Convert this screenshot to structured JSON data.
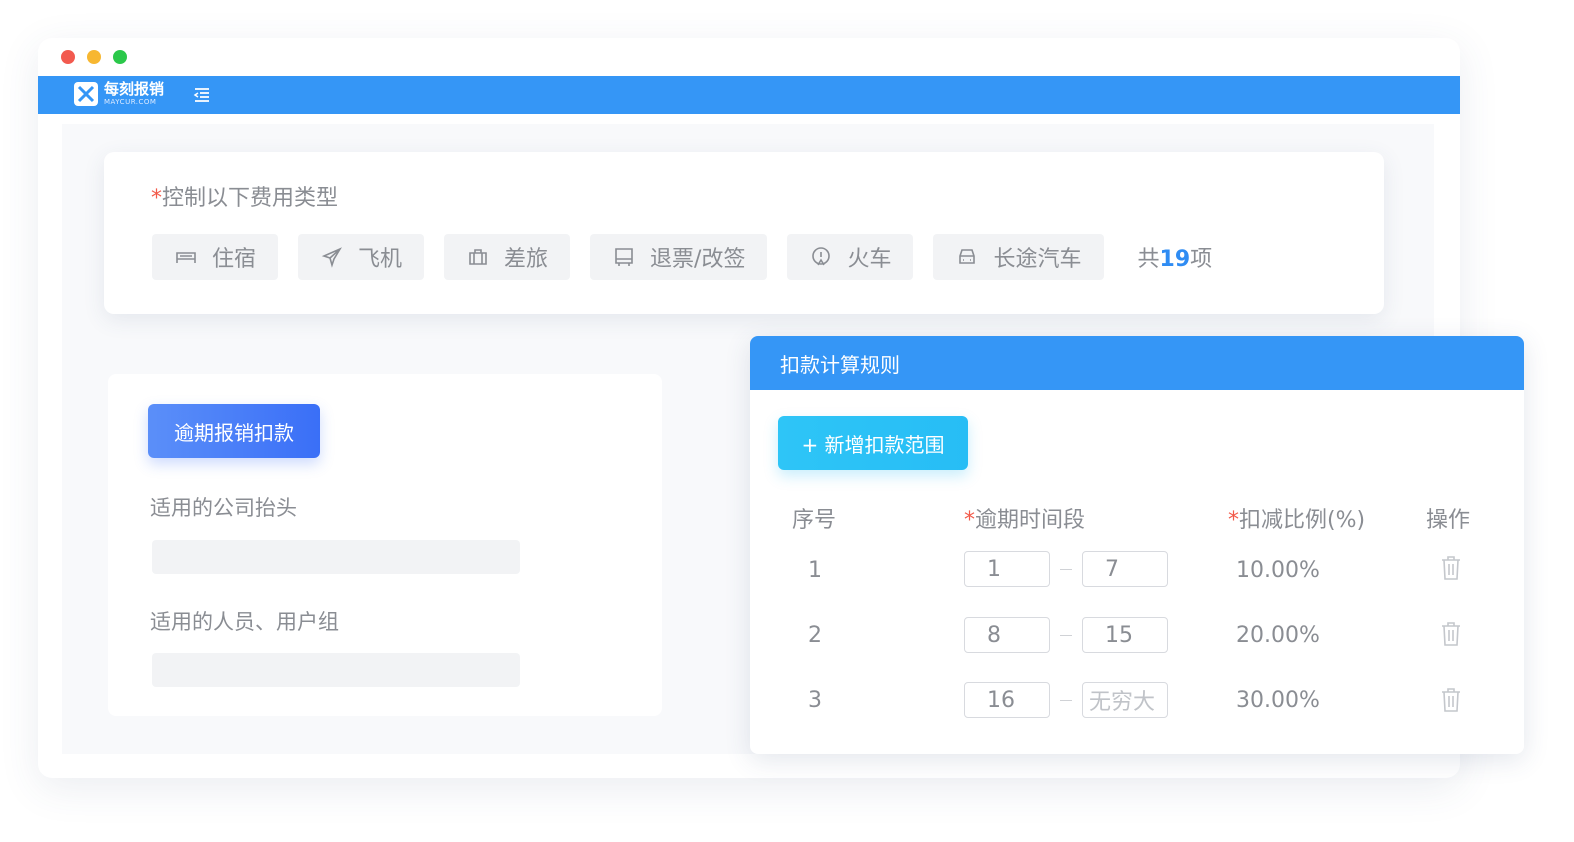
{
  "app": {
    "logo_name": "每刻报销",
    "logo_sub": "MAYCUR.COM",
    "accent": "#3596f6"
  },
  "expense_types": {
    "required_mark": "*",
    "title": "控制以下费用类型",
    "chips": [
      {
        "label": "住宿",
        "icon": "bed-icon"
      },
      {
        "label": "飞机",
        "icon": "airplane-icon"
      },
      {
        "label": "差旅",
        "icon": "briefcase-icon"
      },
      {
        "label": "退票/改签",
        "icon": "bus-icon"
      },
      {
        "label": "火车",
        "icon": "train-icon"
      },
      {
        "label": "长途汽车",
        "icon": "car-icon"
      }
    ],
    "total_prefix": "共",
    "total_count": "19",
    "total_suffix": "项"
  },
  "left_panel": {
    "rule_button": "逾期报销扣款",
    "company_label": "适用的公司抬头",
    "people_label": "适用的人员、用户组"
  },
  "rule_panel": {
    "header": "扣款计算规则",
    "add_button": "+ 新增扣款范围",
    "columns": {
      "index": "序号",
      "period_mark": "*",
      "period": "逾期时间段",
      "ratio_mark": "*",
      "ratio": "扣减比例(%)",
      "action": "操作"
    },
    "rows": [
      {
        "index": "1",
        "from": "1",
        "to": "7",
        "to_placeholder": "",
        "ratio": "10.00%"
      },
      {
        "index": "2",
        "from": "8",
        "to": "15",
        "to_placeholder": "",
        "ratio": "20.00%"
      },
      {
        "index": "3",
        "from": "16",
        "to": "",
        "to_placeholder": "无穷大",
        "ratio": "30.00%"
      }
    ]
  }
}
